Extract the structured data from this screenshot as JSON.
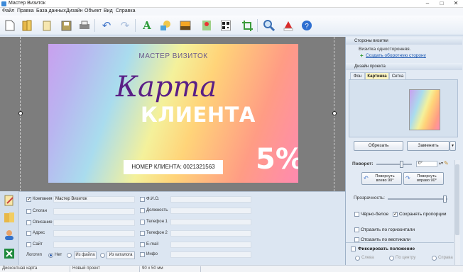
{
  "window": {
    "title": "Мастер Визиток"
  },
  "menu": [
    "Файл",
    "Правка",
    "База данных",
    "Дизайн",
    "Объект",
    "Вид",
    "Справка"
  ],
  "toolbar": {
    "icons": [
      "new-file-icon",
      "open-folder-icon",
      "templates-icon",
      "save-icon",
      "print-icon",
      "undo-icon",
      "redo-icon",
      "text-icon",
      "shapes-icon",
      "image-icon",
      "map-icon",
      "qr-code-icon",
      "crop-icon",
      "zoom-icon",
      "christmas-icon",
      "help-icon"
    ]
  },
  "card": {
    "brand": "МАСТЕР ВИЗИТОК",
    "script_title": "Карта",
    "title": "КЛИЕНТА",
    "client_number": "НОМЕР КЛИЕНТА: 0021321563",
    "discount": "5%"
  },
  "fields": {
    "left": [
      {
        "label": "Компания",
        "value": "Мастер Визиток",
        "checked": true
      },
      {
        "label": "Слоган",
        "value": "",
        "checked": false
      },
      {
        "label": "Описание",
        "value": "",
        "checked": false
      },
      {
        "label": "Адрес",
        "value": "",
        "checked": false
      },
      {
        "label": "Сайт",
        "value": "",
        "checked": false
      }
    ],
    "right": [
      {
        "label": "Ф.И.О.",
        "checked": false
      },
      {
        "label": "Должность",
        "checked": false
      },
      {
        "label": "Телефон 1",
        "checked": false
      },
      {
        "label": "Телефон 2",
        "checked": false
      },
      {
        "label": "E-mail",
        "checked": false
      },
      {
        "label": "Инфо",
        "checked": false
      }
    ],
    "logo_label": "Логотип",
    "logo_none": "Нет",
    "logo_from_file": "Из файла",
    "logo_from_catalog": "Из каталога"
  },
  "right_panel": {
    "sides_header": "Стороны визитки",
    "sides_info": "Визитка односторонняя.",
    "create_back_link": "Создать оборотную сторону",
    "design_header": "Дизайн проекта",
    "tabs": [
      "Фон",
      "Картинка",
      "Сетка"
    ],
    "active_tab": "Картинка",
    "crop_button": "Обрезать",
    "replace_button": "Заменить",
    "rotation_label": "Поворот:",
    "rotation_value": "0°",
    "rotate_left": "Повернуть\nвлево 90°",
    "rotate_right": "Повернуть\nвправо 90°",
    "transparency_label": "Прозрачность:",
    "bw_label": "Чёрно-белое",
    "keep_ratio_label": "Сохранять пропорции",
    "flip_h_label": "Отразить по горизонтали",
    "flip_v_label": "Отразить по вертикали",
    "fix_position_label": "Фиксировать положение",
    "align_left": "Слева",
    "align_center": "По центру",
    "align_right": "Справа"
  },
  "status": {
    "card_type": "Дисконтная карта",
    "project": "Новый проект",
    "size": "90 x 50 мм"
  },
  "colors": {
    "accent_link": "#1a56b0",
    "active_tab": "#fff6c2",
    "card_title": "#5a1f86"
  }
}
